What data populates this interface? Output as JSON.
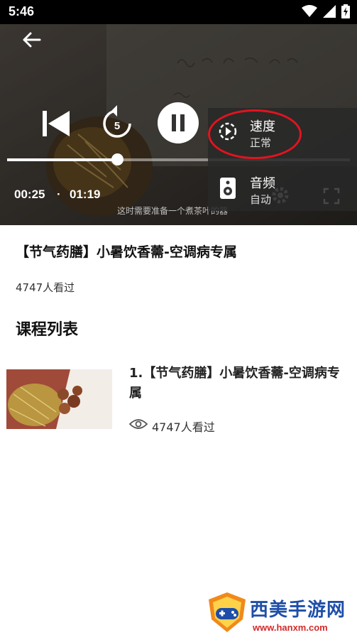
{
  "status_bar": {
    "time": "5:46",
    "icons": [
      "wifi-icon",
      "signal-icon",
      "battery-charging-icon"
    ]
  },
  "player": {
    "current_time": "00:25",
    "separator": "·",
    "total_time": "01:19",
    "progress": 0.32,
    "replay_seconds": "5",
    "subtitle": "这时需要准备一个煮茶叶的器",
    "state": "playing",
    "settings_menu": {
      "speed": {
        "label": "速度",
        "value": "正常"
      },
      "audio": {
        "label": "音频",
        "value": "自动"
      }
    }
  },
  "course": {
    "title": "【节气药膳】小暑饮香薷-空调病专属",
    "views": "4747人看过"
  },
  "section": {
    "title": "课程列表"
  },
  "lessons": [
    {
      "title": "1.【节气药膳】小暑饮香薷-空调病专属",
      "views": "4747人看过"
    }
  ],
  "watermark": {
    "name": "西美手游网",
    "url": "www.hanxm.com"
  },
  "colors": {
    "highlight": "#e0141e",
    "watermark_blue": "#1e4ea8",
    "watermark_red": "#d42a2a"
  }
}
